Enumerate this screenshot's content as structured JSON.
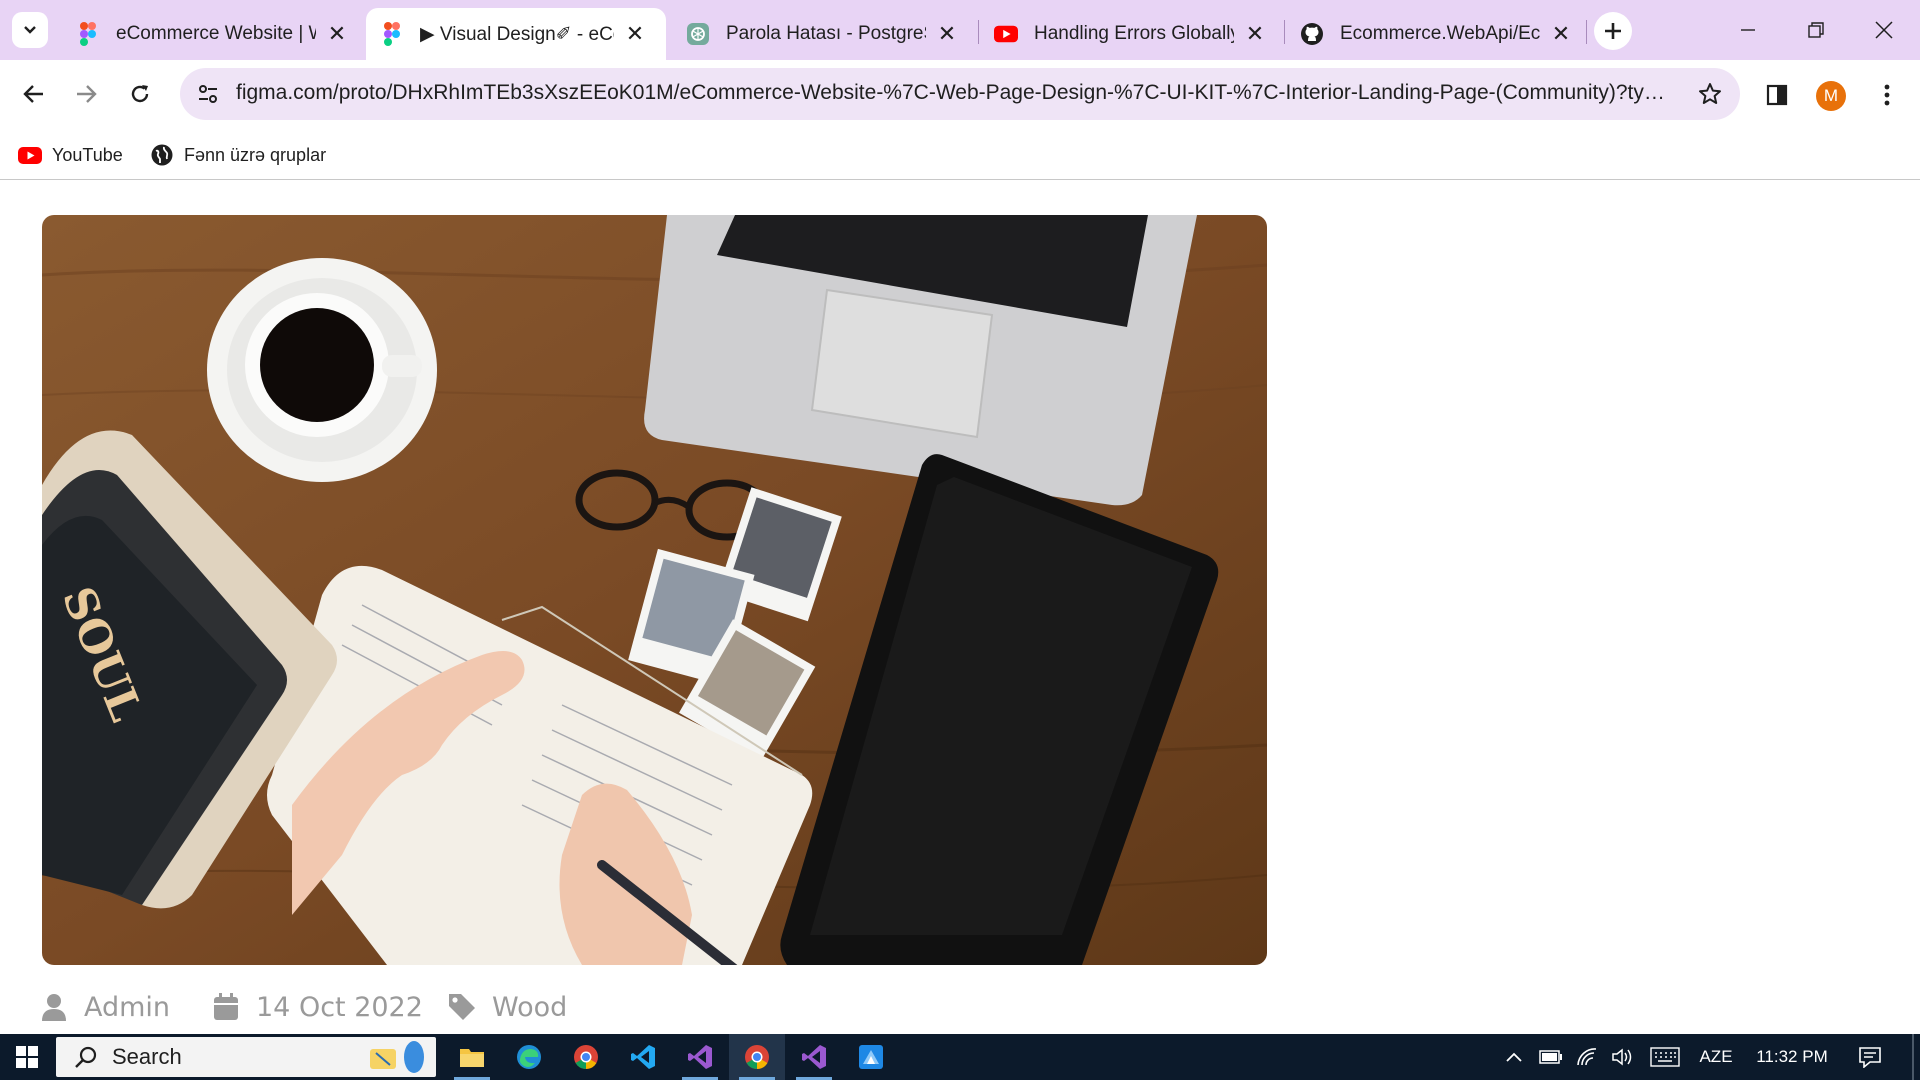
{
  "browser": {
    "tabs": [
      {
        "title": "eCommerce Website | We",
        "icon": "figma-icon",
        "active": false
      },
      {
        "title": "▶ Visual Design✐ - eCor",
        "icon": "figma-icon",
        "active": true
      },
      {
        "title": "Parola Hatası - PostgreSC",
        "icon": "chatgpt-icon",
        "active": false
      },
      {
        "title": "Handling Errors Globally",
        "icon": "youtube-icon",
        "active": false
      },
      {
        "title": "Ecommerce.WebApi/Ecor",
        "icon": "github-icon",
        "active": false
      }
    ],
    "url": "figma.com/proto/DHxRhImTEb3sXszEEoK01M/eCommerce-Website-%7C-Web-Page-Design-%7C-UI-KIT-%7C-Interior-Landing-Page-(Community)?type=...",
    "profile_initial": "M",
    "profile_color": "#e8710a",
    "bookmarks": [
      {
        "label": "YouTube",
        "icon": "youtube-icon"
      },
      {
        "label": "Fənn üzrə qruplar",
        "icon": "globe-icon"
      }
    ]
  },
  "page": {
    "hero_image": "desk-with-laptop-coffee-notebook-tablet-photo",
    "meta": {
      "author": "Admin",
      "date": "14 Oct 2022",
      "tag": "Wood"
    }
  },
  "taskbar": {
    "search_label": "Search",
    "language": "AZE",
    "time": "11:32 PM",
    "apps": [
      "file-explorer-icon",
      "edge-icon",
      "chrome-icon",
      "vscode-icon",
      "visual-studio-icon",
      "chrome-icon",
      "visual-studio-icon",
      "azure-data-studio-icon"
    ]
  },
  "colors": {
    "tabstrip": "#e8d4f5",
    "omnibox": "#efe4f6",
    "meta_text": "#9a9a9a",
    "taskbar": "#0c1a2b"
  }
}
